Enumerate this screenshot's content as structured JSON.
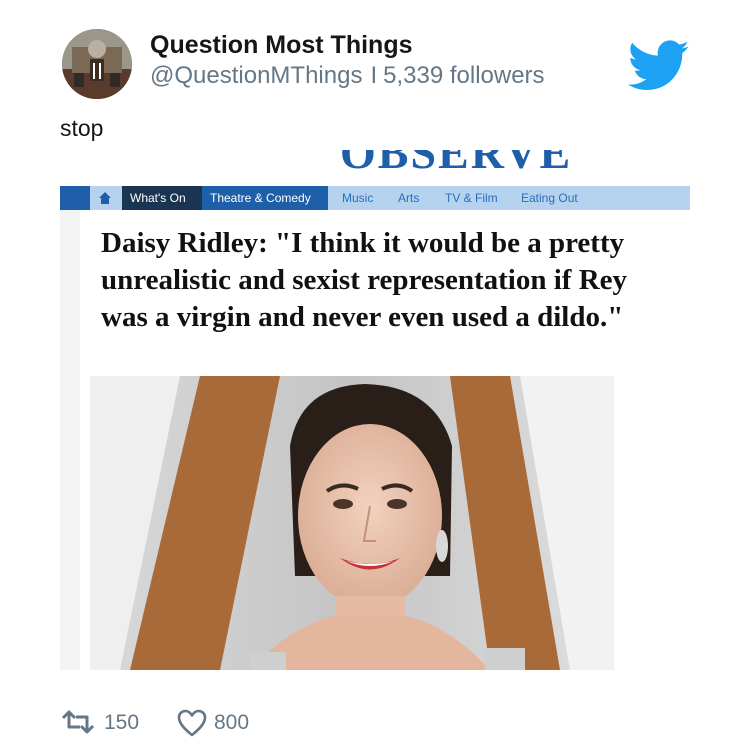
{
  "user": {
    "display_name": "Question Most Things",
    "handle": "@QuestionMThings",
    "separator": "I",
    "followers": "5,339 followers"
  },
  "tweet": {
    "text": "stop"
  },
  "embedded_article": {
    "masthead": "OBSERVER",
    "nav": {
      "items": [
        "What's On",
        "Theatre & Comedy",
        "Music",
        "Arts",
        "TV & Film",
        "Eating Out"
      ]
    },
    "headline": "Daisy Ridley: \"I think it would be a pretty unrealistic and sexist representation if Rey was a virgin and never even used a dildo.\""
  },
  "actions": {
    "retweets": "150",
    "likes": "800"
  },
  "colors": {
    "twitter_blue": "#1da1f2",
    "nav_light": "#b5d3ef",
    "nav_dark": "#1a3552",
    "nav_mid": "#1f5ea8",
    "secondary_text": "#657786"
  },
  "icons": [
    "avatar",
    "twitter-bird-icon",
    "home-icon",
    "retweet-icon",
    "heart-icon"
  ]
}
